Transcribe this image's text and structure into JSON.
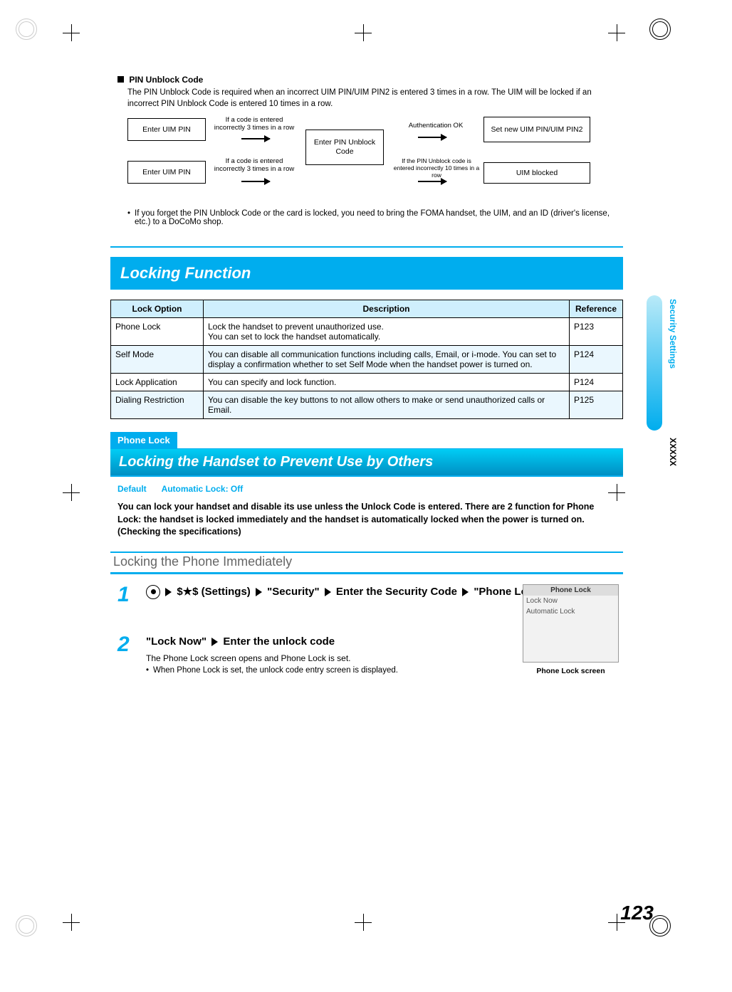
{
  "pin": {
    "heading": "PIN Unblock Code",
    "desc": "The PIN Unblock Code is required when an incorrect UIM PIN/UIM PIN2 is entered 3 times in a row. The UIM will be locked if an incorrect PIN Unblock Code is entered 10 times in a row.",
    "box_enter_uim_pin_1": "Enter UIM PIN",
    "box_enter_uim_pin_2": "Enter UIM PIN",
    "label_wrong3_a": "If a code is entered incorrectly 3 times in a row",
    "label_wrong3_b": "If a code is entered incorrectly 3 times in a row",
    "box_enter_unblock": "Enter PIN Unblock Code",
    "label_auth_ok": "Authentication OK",
    "label_wrong10": "If the PIN Unblock code is entered incorrectly 10 times in a row",
    "box_set_new": "Set new UIM PIN/UIM PIN2",
    "box_uim_blocked": "UIM blocked",
    "forget_note": "If you forget the PIN Unblock Code or the card is locked, you need to bring the FOMA handset, the UIM, and an ID (driver's license, etc.) to a DoCoMo shop."
  },
  "locking_section_title": "Locking Function",
  "table": {
    "headers": {
      "opt": "Lock Option",
      "desc": "Description",
      "ref": "Reference"
    },
    "rows": [
      {
        "opt": "Phone Lock",
        "desc": "Lock the handset to prevent unauthorized use.\nYou can set to lock the handset automatically.",
        "ref": "P123"
      },
      {
        "opt": "Self Mode",
        "desc": "You can disable all communication functions including calls, Email, or i-mode. You can set to display a confirmation whether to set Self Mode when the handset power is turned on.",
        "ref": "P124"
      },
      {
        "opt": "Lock Application",
        "desc": "You can specify and lock function.",
        "ref": "P124"
      },
      {
        "opt": "Dialing Restriction",
        "desc": "You can disable the key buttons to not allow others to make or send unauthorized calls or Email.",
        "ref": "P125"
      }
    ]
  },
  "phone_lock": {
    "label": "Phone Lock",
    "title": "Locking the Handset to Prevent Use by Others",
    "default_label": "Default",
    "default_value": "Automatic Lock: Off",
    "intro": "You can lock your handset and disable its use unless the Unlock Code is entered. There are 2 function for Phone Lock: the handset is locked immediately and the handset is automatically locked when the power is turned on.\n(Checking the specifications)",
    "h3": "Locking the Phone Immediately"
  },
  "steps": {
    "s1": {
      "num": "1",
      "seg1": "$★$ (Settings)",
      "seg2": "\"Security\"",
      "seg3": "Enter the Security Code",
      "seg4": "\"Phone Lock\""
    },
    "s2": {
      "num": "2",
      "seg1": "\"Lock Now\"",
      "seg2": "Enter the unlock code",
      "note": "The Phone Lock screen opens and Phone Lock is set.",
      "bullet": "When Phone Lock is set, the unlock code entry screen is displayed."
    }
  },
  "phone_mock": {
    "title": "Phone Lock",
    "row1": "Lock Now",
    "row2": "Automatic Lock",
    "caption": "Phone Lock screen"
  },
  "side": {
    "chapter": "Security Settings",
    "marker": "XXXXX"
  },
  "page_number": "123"
}
